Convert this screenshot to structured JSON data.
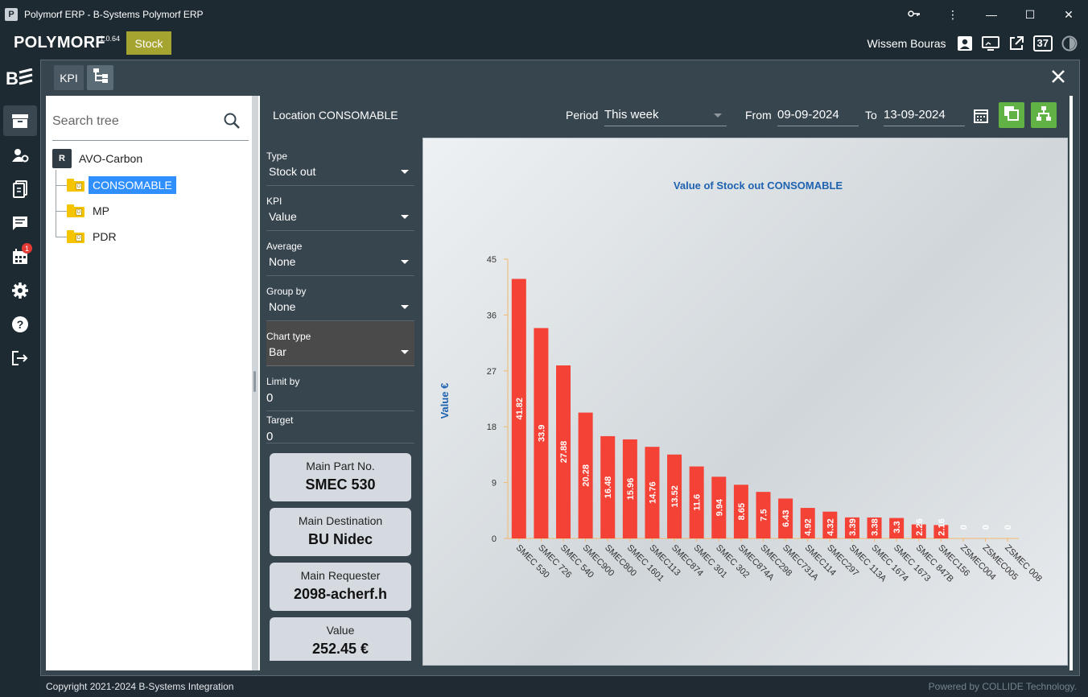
{
  "window": {
    "title": "Polymorf ERP - B-Systems Polymorf ERP",
    "controls": [
      "key-icon",
      "more-icon",
      "minimize-icon",
      "maximize-icon",
      "close-icon"
    ]
  },
  "app": {
    "brand": "POLYMORF",
    "version": "1.0.64",
    "module": "Stock",
    "user_name": "Wissem Bouras",
    "count": "37",
    "accent_color": "#a6a431"
  },
  "nav": {
    "items": [
      "stock-icon",
      "users-settings-icon",
      "documents-icon",
      "chat-icon",
      "calendar-icon",
      "settings-icon",
      "help-icon",
      "logout-icon"
    ],
    "calendar_badge": "1"
  },
  "tabs": {
    "kpi": "KPI"
  },
  "tree": {
    "search_placeholder": "Search tree",
    "root": {
      "label": "AVO-Carbon",
      "icon_text": "R"
    },
    "children": [
      {
        "label": "CONSOMABLE",
        "selected": true
      },
      {
        "label": "MP",
        "selected": false
      },
      {
        "label": "PDR",
        "selected": false
      }
    ]
  },
  "toolbar": {
    "location": "Location CONSOMABLE",
    "period_label": "Period",
    "period_value": "This week",
    "from_label": "From",
    "from_value": "09-09-2024",
    "to_label": "To",
    "to_value": "13-09-2024"
  },
  "form": {
    "type": {
      "label": "Type",
      "value": "Stock out"
    },
    "kpi": {
      "label": "KPI",
      "value": "Value"
    },
    "average": {
      "label": "Average",
      "value": "None"
    },
    "group_by": {
      "label": "Group by",
      "value": "None"
    },
    "chart_type": {
      "label": "Chart type",
      "value": "Bar"
    },
    "limit_by": {
      "label": "Limit by",
      "value": "0"
    },
    "target": {
      "label": "Target",
      "value": "0"
    }
  },
  "cards": [
    {
      "title": "Main Part No.",
      "value": "SMEC 530"
    },
    {
      "title": "Main Destination",
      "value": "BU Nidec"
    },
    {
      "title": "Main Requester",
      "value": "2098-acherf.h"
    },
    {
      "title": "Value",
      "value": "252.45 €"
    }
  ],
  "footer": {
    "copyright": "Copyright 2021-2024 B-Systems Integration",
    "powered": "Powered by COLLIDE Technology."
  },
  "chart_data": {
    "type": "bar",
    "title": "Value of Stock out CONSOMABLE",
    "xlabel": "",
    "ylabel": "Value €",
    "ylim": [
      0,
      45
    ],
    "yticks": [
      0,
      9,
      18,
      27,
      36,
      45
    ],
    "categories": [
      "SMEC 530",
      "SMEC 726",
      "SMEC 540",
      "SMEC900",
      "SMEC800",
      "SMEC 1601",
      "SMEC113",
      "SMEC874",
      "SMEC 301",
      "SMEC 302",
      "SMEC874A",
      "SMEC298",
      "SMEC731A",
      "SMEC114",
      "SMEC297",
      "SMEC 113A",
      "SMEC 1674",
      "SMEC 1673",
      "SMEC 847B",
      "SMEC156",
      "ZSMEC004",
      "ZSMEC005",
      "ZSMEC 008"
    ],
    "values": [
      41.82,
      33.9,
      27.88,
      20.28,
      16.48,
      15.96,
      14.76,
      13.52,
      11.6,
      9.94,
      8.65,
      7.5,
      6.43,
      4.92,
      4.32,
      3.39,
      3.38,
      3.3,
      2.26,
      2.16,
      0,
      0,
      0
    ],
    "bar_color": "#f44336",
    "axis_color": "#f5b86a",
    "title_color": "#1e62b0",
    "grid": false
  }
}
